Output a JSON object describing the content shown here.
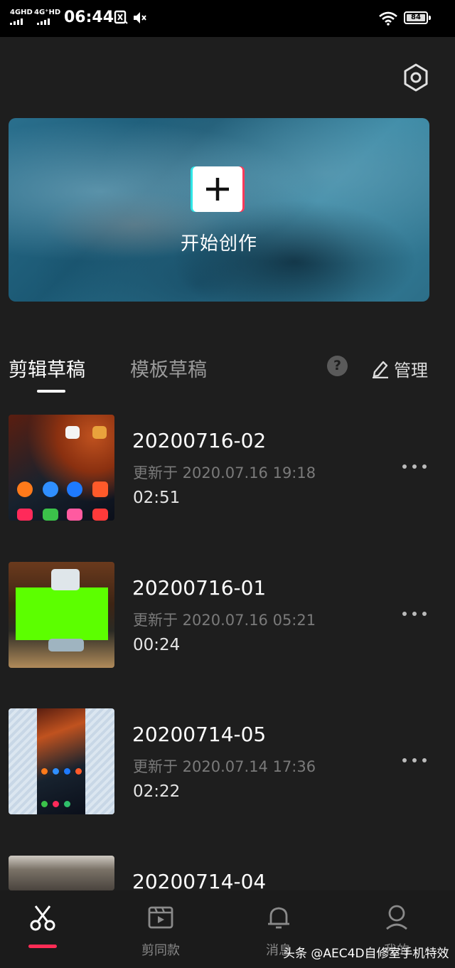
{
  "status_bar": {
    "network_1": "4GHD",
    "network_2": "4G⁺HD",
    "time": "06:44",
    "battery": "84"
  },
  "create": {
    "label": "开始创作",
    "icon": "plus-icon"
  },
  "tabs": {
    "active": "剪辑草稿",
    "inactive": "模板草稿",
    "help": "?",
    "manage": "管理"
  },
  "drafts": [
    {
      "title": "20200716-02",
      "updated": "更新于 2020.07.16 19:18",
      "duration": "02:51"
    },
    {
      "title": "20200716-01",
      "updated": "更新于 2020.07.16 05:21",
      "duration": "00:24"
    },
    {
      "title": "20200714-05",
      "updated": "更新于 2020.07.14 17:36",
      "duration": "02:22"
    },
    {
      "title": "20200714-04"
    }
  ],
  "bottom_nav": {
    "items": [
      {
        "icon": "scissors-icon",
        "label": ""
      },
      {
        "icon": "template-play-icon",
        "label": "剪同款"
      },
      {
        "icon": "bell-icon",
        "label": "消息"
      },
      {
        "icon": "person-icon",
        "label": "我的"
      }
    ]
  },
  "watermark": "头条 @AEC4D自修室手机特效",
  "colors": {
    "accent": "#fe2c55",
    "background": "#1e1e1e"
  }
}
